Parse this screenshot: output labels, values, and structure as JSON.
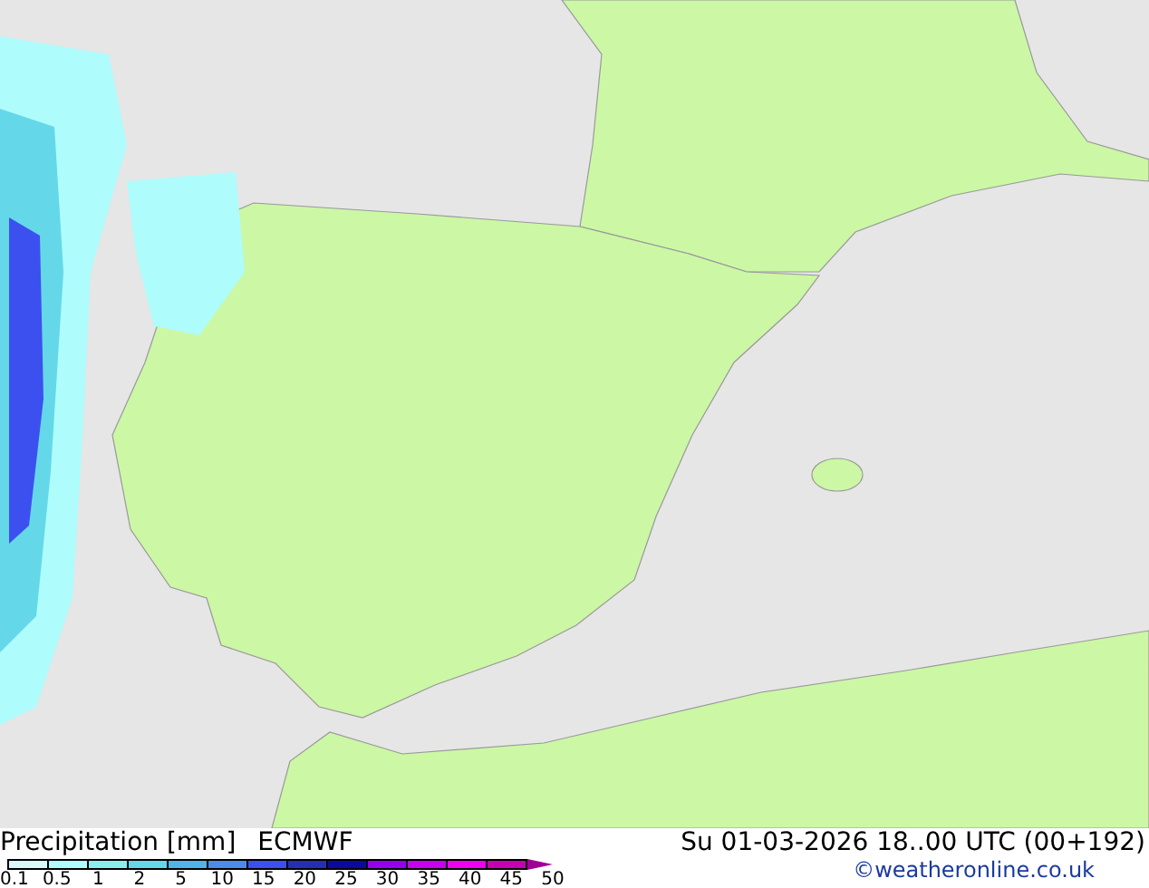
{
  "map": {
    "title": "Precipitation [mm]",
    "model": "ECMWF",
    "valid_time": "Su 01-03-2026 18..00 UTC (00+192)",
    "credit": "©weatheronline.co.uk"
  },
  "legend": {
    "swatches": [
      {
        "color": "#d8fafa"
      },
      {
        "color": "#aefcfc"
      },
      {
        "color": "#8aeeee"
      },
      {
        "color": "#64d8e8"
      },
      {
        "color": "#50b4e8"
      },
      {
        "color": "#4c8ce8"
      },
      {
        "color": "#3c50f0"
      },
      {
        "color": "#2430b4"
      },
      {
        "color": "#0a0aa0"
      },
      {
        "color": "#9600f0"
      },
      {
        "color": "#c800f0"
      },
      {
        "color": "#f000f0"
      },
      {
        "color": "#c800b4"
      }
    ],
    "labels": [
      "0.1",
      "0.5",
      "1",
      "2",
      "5",
      "10",
      "15",
      "20",
      "25",
      "30",
      "35",
      "40",
      "45",
      "50"
    ]
  }
}
